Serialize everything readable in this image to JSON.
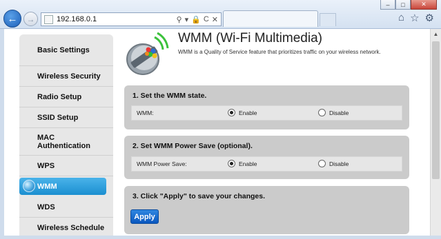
{
  "browser": {
    "url": "192.168.0.1",
    "window_controls": [
      "–",
      "□",
      "✕"
    ],
    "nav_back_icon": "back-arrow-icon",
    "nav_forward_icon": "forward-arrow-icon",
    "address_tools": [
      "⚲",
      "▾",
      "🔒",
      "C",
      "✕"
    ]
  },
  "sidebar": {
    "items": [
      {
        "label": "Basic Settings"
      },
      {
        "label": "Wireless Security"
      },
      {
        "label": "Radio Setup"
      },
      {
        "label": "SSID Setup"
      },
      {
        "label": "MAC Authentication"
      },
      {
        "label": "WPS"
      },
      {
        "label": "WMM"
      },
      {
        "label": "WDS"
      },
      {
        "label": "Wireless Schedule"
      }
    ],
    "active": "WMM"
  },
  "header": {
    "title": "WMM (Wi-Fi Multimedia)",
    "subtitle": "WMM is a Quality of Service feature that prioritizes traffic on your wireless network."
  },
  "sections": [
    {
      "title": "1. Set the WMM state.",
      "row_label": "WMM:",
      "options": [
        "Enable",
        "Disable"
      ],
      "selected": "Enable"
    },
    {
      "title": "2. Set WMM Power Save (optional).",
      "row_label": "WMM Power Save:",
      "options": [
        "Enable",
        "Disable"
      ],
      "selected": "Enable"
    },
    {
      "title": "3. Click \"Apply\" to save your changes.",
      "button": "Apply"
    }
  ],
  "colors": {
    "accent": "#1b8fd0",
    "apply_button": "#0a57bf",
    "section_bg": "#cbcbcb",
    "sidebar_bg": "#e7e7e7"
  }
}
